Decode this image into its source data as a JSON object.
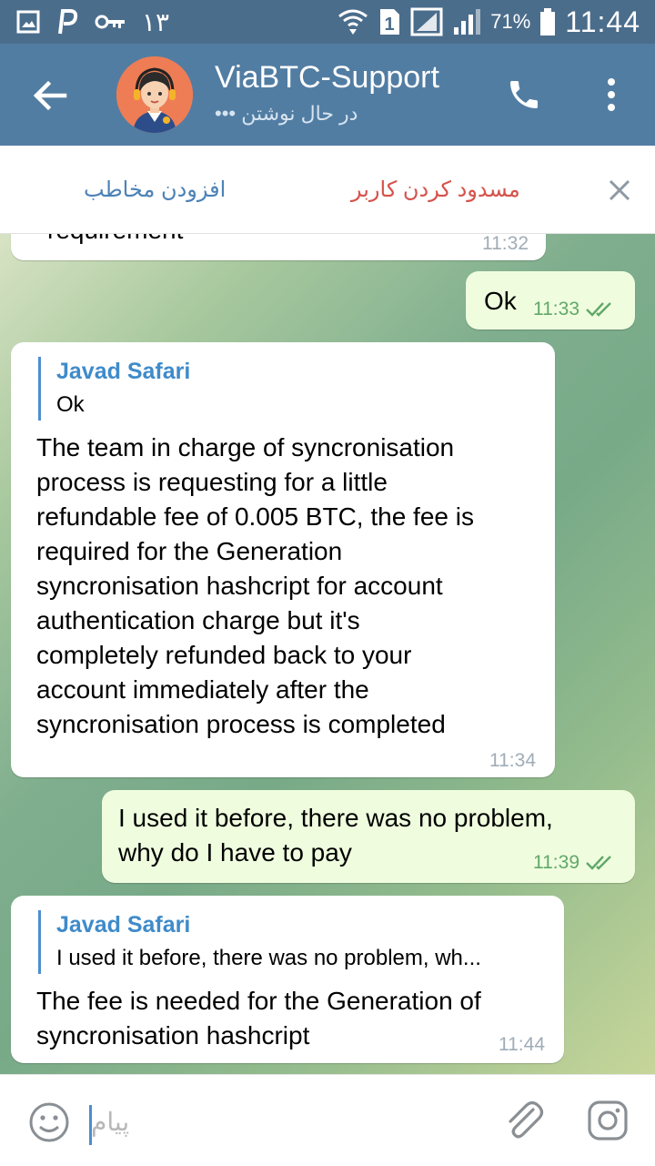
{
  "status_bar": {
    "notification_number": "١٣",
    "sim_number": "1",
    "battery": "71%",
    "time": "11:44"
  },
  "header": {
    "title": "ViaBTC-Support",
    "subtitle": "در حال نوشتن •••"
  },
  "action_bar": {
    "add_contact": "افزودن مخاطب",
    "block_user": "مسدود کردن کاربر"
  },
  "messages": [
    {
      "direction": "incoming",
      "text": "requirement",
      "time": "11:32"
    },
    {
      "direction": "outgoing",
      "text": "Ok",
      "time": "11:33",
      "read": true
    },
    {
      "direction": "incoming",
      "reply_to": {
        "name": "Javad Safari",
        "text": "Ok"
      },
      "lines": [
        "The team in charge of syncronisation",
        "process is requesting for a little",
        "refundable fee of 0.005 BTC, the fee is",
        "required for the Generation",
        "syncronisation hashcript for account",
        "authentication charge but it's",
        "completely refunded back to your",
        "account immediately after the",
        "syncronisation process is completed"
      ],
      "time": "11:34"
    },
    {
      "direction": "outgoing",
      "lines": [
        "I used it before, there was no problem,",
        "why do I have to pay"
      ],
      "time": "11:39",
      "read": true
    },
    {
      "direction": "incoming",
      "reply_to": {
        "name": "Javad Safari",
        "text": "I used it before, there was no problem, wh..."
      },
      "lines": [
        "The fee is needed for the Generation of",
        "syncronisation hashcript"
      ],
      "time": "11:44"
    }
  ],
  "input": {
    "placeholder": "پیام"
  },
  "colors": {
    "status_bar": "#4b6d8c",
    "header": "#527da3",
    "outgoing_bubble": "#effdde",
    "incoming_bubble": "#ffffff",
    "link_blue": "#4c82b6",
    "block_red": "#d6524b",
    "read_check": "#61a86a"
  },
  "icons": [
    "image-icon",
    "p-icon",
    "key-icon",
    "wifi-icon",
    "sim-icon",
    "signal-icon",
    "battery-icon",
    "back-arrow-icon",
    "phone-icon",
    "more-vert-icon",
    "close-icon",
    "double-check-icon",
    "emoji-icon",
    "attach-icon",
    "camera-icon"
  ]
}
